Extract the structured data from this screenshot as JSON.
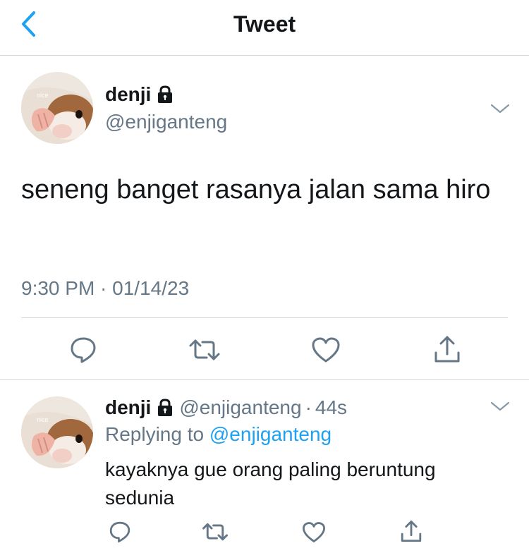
{
  "nav": {
    "title": "Tweet"
  },
  "tweet": {
    "name": "denji",
    "handle": "@enjiganteng",
    "avatar_caption": "nice",
    "text": "seneng banget rasanya jalan sama hiro",
    "timestamp": "9:30 PM · 01/14/23"
  },
  "reply": {
    "name": "denji",
    "handle": "@enjiganteng",
    "separator": "·",
    "time": "44s",
    "avatar_caption": "nice",
    "replying_prefix": "Replying to",
    "replying_handle": "@enjiganteng",
    "text": "kayaknya gue orang paling beruntung sedunia"
  },
  "icons": {
    "back": "chevron-left-icon",
    "lock": "lock-icon",
    "more": "chevron-down-icon",
    "reply": "reply-bubble-icon",
    "retweet": "retweet-icon",
    "like": "heart-icon",
    "share": "share-icon"
  },
  "colors": {
    "accent": "#1da1f2",
    "text": "#14171a",
    "muted": "#657786",
    "divider": "#d6d9dc"
  }
}
